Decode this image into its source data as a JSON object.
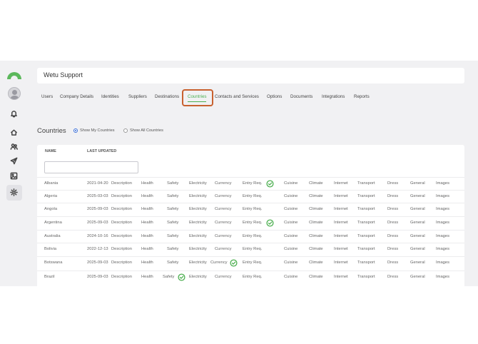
{
  "app": {
    "title": "Wetu Support",
    "accent_color": "#4caf50",
    "highlight_color": "#c8612f"
  },
  "sidebar": {
    "items": [
      {
        "icon": "bell-icon"
      },
      {
        "icon": "home-icon"
      },
      {
        "icon": "users-icon"
      },
      {
        "icon": "send-icon"
      },
      {
        "icon": "image-icon"
      },
      {
        "icon": "gear-icon"
      }
    ]
  },
  "tabs": [
    {
      "label": "Users"
    },
    {
      "label": "Company Details"
    },
    {
      "label": "Identities"
    },
    {
      "label": "Suppliers"
    },
    {
      "label": "Destinations"
    },
    {
      "label": "Countries",
      "active": true
    },
    {
      "label": "Contacts and Services"
    },
    {
      "label": "Options"
    },
    {
      "label": "Documents"
    },
    {
      "label": "Integrations"
    },
    {
      "label": "Reports"
    }
  ],
  "countries_section": {
    "title": "Countries",
    "radio_my": "Show My Countries",
    "radio_all": "Show All Countries",
    "selected": "Show My Countries"
  },
  "table": {
    "columns": {
      "name": "NAME",
      "last_updated": "LAST UPDATED"
    },
    "filter_value": "",
    "rows": [
      {
        "country": "Albania",
        "date": "2021-04-20",
        "links": [
          "Description",
          "Health",
          "Safety",
          "Electricity",
          "Currency",
          "Entry Req.",
          "Cuisine",
          "Climate",
          "Internet",
          "Transport",
          "Dress",
          "General",
          "Images"
        ],
        "checked": [
          "Entry Req."
        ]
      },
      {
        "country": "Algeria",
        "date": "2025-03-03",
        "links": [
          "Description",
          "Health",
          "Safety",
          "Electricity",
          "Currency",
          "Entry Req.",
          "Cuisine",
          "Climate",
          "Internet",
          "Transport",
          "Dress",
          "General",
          "Images"
        ],
        "checked": []
      },
      {
        "country": "Angola",
        "date": "2025-09-03",
        "links": [
          "Description",
          "Health",
          "Safety",
          "Electricity",
          "Currency",
          "Entry Req.",
          "Cuisine",
          "Climate",
          "Internet",
          "Transport",
          "Dress",
          "General",
          "Images"
        ],
        "checked": []
      },
      {
        "country": "Argentina",
        "date": "2025-09-03",
        "links": [
          "Description",
          "Health",
          "Safety",
          "Electricity",
          "Currency",
          "Entry Req.",
          "Cuisine",
          "Climate",
          "Internet",
          "Transport",
          "Dress",
          "General",
          "Images"
        ],
        "checked": [
          "Entry Req."
        ]
      },
      {
        "country": "Australia",
        "date": "2024-10-16",
        "links": [
          "Description",
          "Health",
          "Safety",
          "Electricity",
          "Currency",
          "Entry Req.",
          "Cuisine",
          "Climate",
          "Internet",
          "Transport",
          "Dress",
          "General",
          "Images"
        ],
        "checked": []
      },
      {
        "country": "Bolivia",
        "date": "2022-12-13",
        "links": [
          "Description",
          "Health",
          "Safety",
          "Electricity",
          "Currency",
          "Entry Req.",
          "Cuisine",
          "Climate",
          "Internet",
          "Transport",
          "Dress",
          "General",
          "Images"
        ],
        "checked": []
      },
      {
        "country": "Botswana",
        "date": "2025-09-03",
        "links": [
          "Description",
          "Health",
          "Safety",
          "Electricity",
          "Currency",
          "Entry Req.",
          "Cuisine",
          "Climate",
          "Internet",
          "Transport",
          "Dress",
          "General",
          "Images"
        ],
        "checked": [
          "Currency"
        ]
      },
      {
        "country": "Brazil",
        "date": "2025-09-03",
        "links": [
          "Description",
          "Health",
          "Safety",
          "Electricity",
          "Currency",
          "Entry Req.",
          "Cuisine",
          "Climate",
          "Internet",
          "Transport",
          "Dress",
          "General",
          "Images"
        ],
        "checked": [
          "Safety"
        ]
      }
    ]
  }
}
